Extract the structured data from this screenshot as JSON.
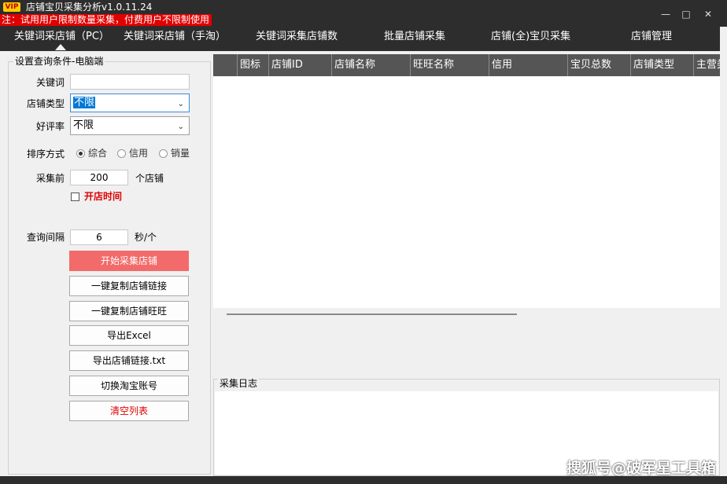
{
  "window": {
    "badge": "VIP",
    "title": "店铺宝贝采集分析v1.0.11.24",
    "notice": "注：试用用户限制数量采集，付费用户不限制使用",
    "controls": {
      "minimize": "minimize-icon",
      "maximize": "maximize-icon",
      "close": "close-icon"
    }
  },
  "nav": {
    "tabs": [
      {
        "label": "关键词采店铺（PC）",
        "active": true
      },
      {
        "label": "关键词采店铺（手淘）"
      },
      {
        "label": "关键词采集店铺数"
      },
      {
        "label": "批量店铺采集"
      },
      {
        "label": "店铺(全)宝贝采集"
      },
      {
        "label": "店铺管理"
      }
    ]
  },
  "form": {
    "group_title": "设置查询条件-电脑端",
    "keyword_label": "关键词",
    "keyword_value": "",
    "shop_type_label": "店铺类型",
    "shop_type_value": "不限",
    "rating_label": "好评率",
    "rating_value": "不限",
    "sort_label": "排序方式",
    "sort_options": [
      {
        "label": "综合",
        "checked": true
      },
      {
        "label": "信用",
        "checked": false
      },
      {
        "label": "销量",
        "checked": false
      }
    ],
    "collect_label": "采集前",
    "collect_value": "200",
    "collect_unit": "个店铺",
    "open_time_label": "开店时间",
    "open_time_checked": false,
    "interval_label": "查询间隔",
    "interval_value": "6",
    "interval_unit": "秒/个"
  },
  "buttons": {
    "start": "开始采集店铺",
    "copy_link": "一键复制店铺链接",
    "copy_wangwang": "一键复制店铺旺旺",
    "export_excel": "导出Excel",
    "export_txt": "导出店铺链接.txt",
    "switch_account": "切换淘宝账号",
    "clear_list": "清空列表"
  },
  "table": {
    "columns": [
      "",
      "图标",
      "店铺ID",
      "店铺名称",
      "旺旺名称",
      "信用",
      "宝贝总数",
      "店铺类型",
      "主营类"
    ],
    "rows": []
  },
  "log": {
    "title": "采集日志"
  },
  "watermark": "搜狐号@破军星工具箱",
  "colors": {
    "titlebar": "#2d2d2d",
    "notice_bg": "#e00000",
    "primary_button": "#f36a6a",
    "table_header": "#555555",
    "danger_text": "#e00000"
  }
}
